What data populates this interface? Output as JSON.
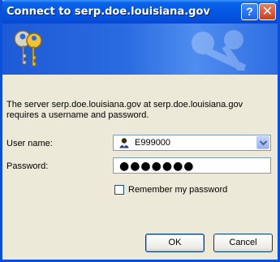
{
  "window": {
    "title": "Connect to serp.doe.louisiana.gov",
    "help_label": "?",
    "close_label": "✕"
  },
  "message": "The server serp.doe.louisiana.gov at serp.doe.louisiana.gov requires a username and password.",
  "form": {
    "username_label": "User name:",
    "username_value": "E999000",
    "password_label": "Password:",
    "password_mask": "●●●●●●●",
    "remember_label": "Remember my password",
    "remember_checked": false
  },
  "buttons": {
    "ok": "OK",
    "cancel": "Cancel"
  },
  "icons": [
    "keys-icon",
    "user-icon",
    "dropdown-arrow-icon"
  ],
  "colors": {
    "titlebar": "#0553de",
    "dialog_bg": "#ece9d8",
    "banner": "#2a6be0"
  }
}
